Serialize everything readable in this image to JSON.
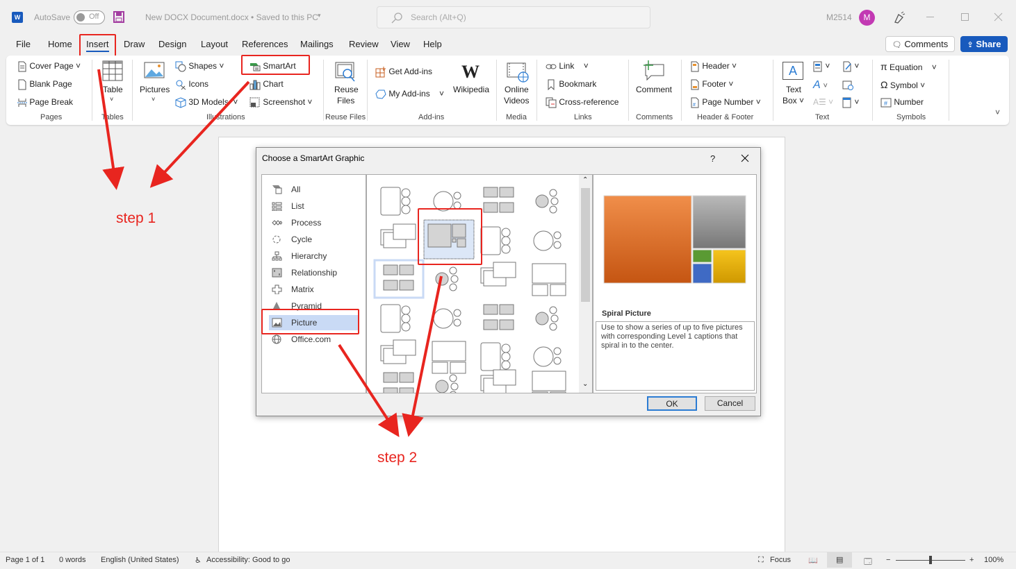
{
  "titlebar": {
    "autosave_label": "AutoSave",
    "autosave_state": "Off",
    "document_title": "New DOCX Document.docx • Saved to this PC",
    "search_placeholder": "Search (Alt+Q)",
    "user_name": "M2514",
    "avatar_initial": "M"
  },
  "tabs": [
    "File",
    "Home",
    "Insert",
    "Draw",
    "Design",
    "Layout",
    "References",
    "Mailings",
    "Review",
    "View",
    "Help"
  ],
  "active_tab": "Insert",
  "header_buttons": {
    "comments": "Comments",
    "share": "Share"
  },
  "ribbon": {
    "pages": {
      "label": "Pages",
      "items": [
        "Cover Page",
        "Blank Page",
        "Page Break"
      ]
    },
    "tables": {
      "label": "Tables",
      "items": [
        "Table"
      ]
    },
    "illustrations": {
      "label": "Illustrations",
      "items": [
        "Pictures",
        "Shapes",
        "Icons",
        "3D Models",
        "SmartArt",
        "Chart",
        "Screenshot"
      ]
    },
    "reuse": {
      "label": "Reuse Files",
      "items": [
        "Reuse",
        "Files"
      ]
    },
    "addins": {
      "label": "Add-ins",
      "items": [
        "Get Add-ins",
        "My Add-ins",
        "Wikipedia"
      ]
    },
    "media": {
      "label": "Media",
      "items": [
        "Online",
        "Videos"
      ]
    },
    "links": {
      "label": "Links",
      "items": [
        "Link",
        "Bookmark",
        "Cross-reference"
      ]
    },
    "comments": {
      "label": "Comments",
      "items": [
        "Comment"
      ]
    },
    "header_footer": {
      "label": "Header & Footer",
      "items": [
        "Header",
        "Footer",
        "Page Number"
      ]
    },
    "text": {
      "label": "Text",
      "items": [
        "Text",
        "Box"
      ]
    },
    "symbols": {
      "label": "Symbols",
      "items": [
        "Equation",
        "Symbol",
        "Number"
      ]
    }
  },
  "dialog": {
    "title": "Choose a SmartArt Graphic",
    "help": "?",
    "categories": [
      "All",
      "List",
      "Process",
      "Cycle",
      "Hierarchy",
      "Relationship",
      "Matrix",
      "Pyramid",
      "Picture",
      "Office.com"
    ],
    "selected_category": "Picture",
    "selected_layout_name": "Spiral Picture",
    "selected_layout_description": "Use to show a series of up to five pictures with corresponding Level 1 captions that spiral in to the center.",
    "ok": "OK",
    "cancel": "Cancel"
  },
  "annotations": {
    "step1": "step 1",
    "step2": "step 2",
    "color": "#e8251f"
  },
  "statusbar": {
    "page": "Page 1 of 1",
    "words": "0 words",
    "language": "English (United States)",
    "accessibility": "Accessibility: Good to go",
    "focus": "Focus",
    "zoom": "100%",
    "zoom_percent": 100
  },
  "colors": {
    "accent": "#185abd",
    "avatar": "#c239b3",
    "annotation": "#e8251f"
  }
}
